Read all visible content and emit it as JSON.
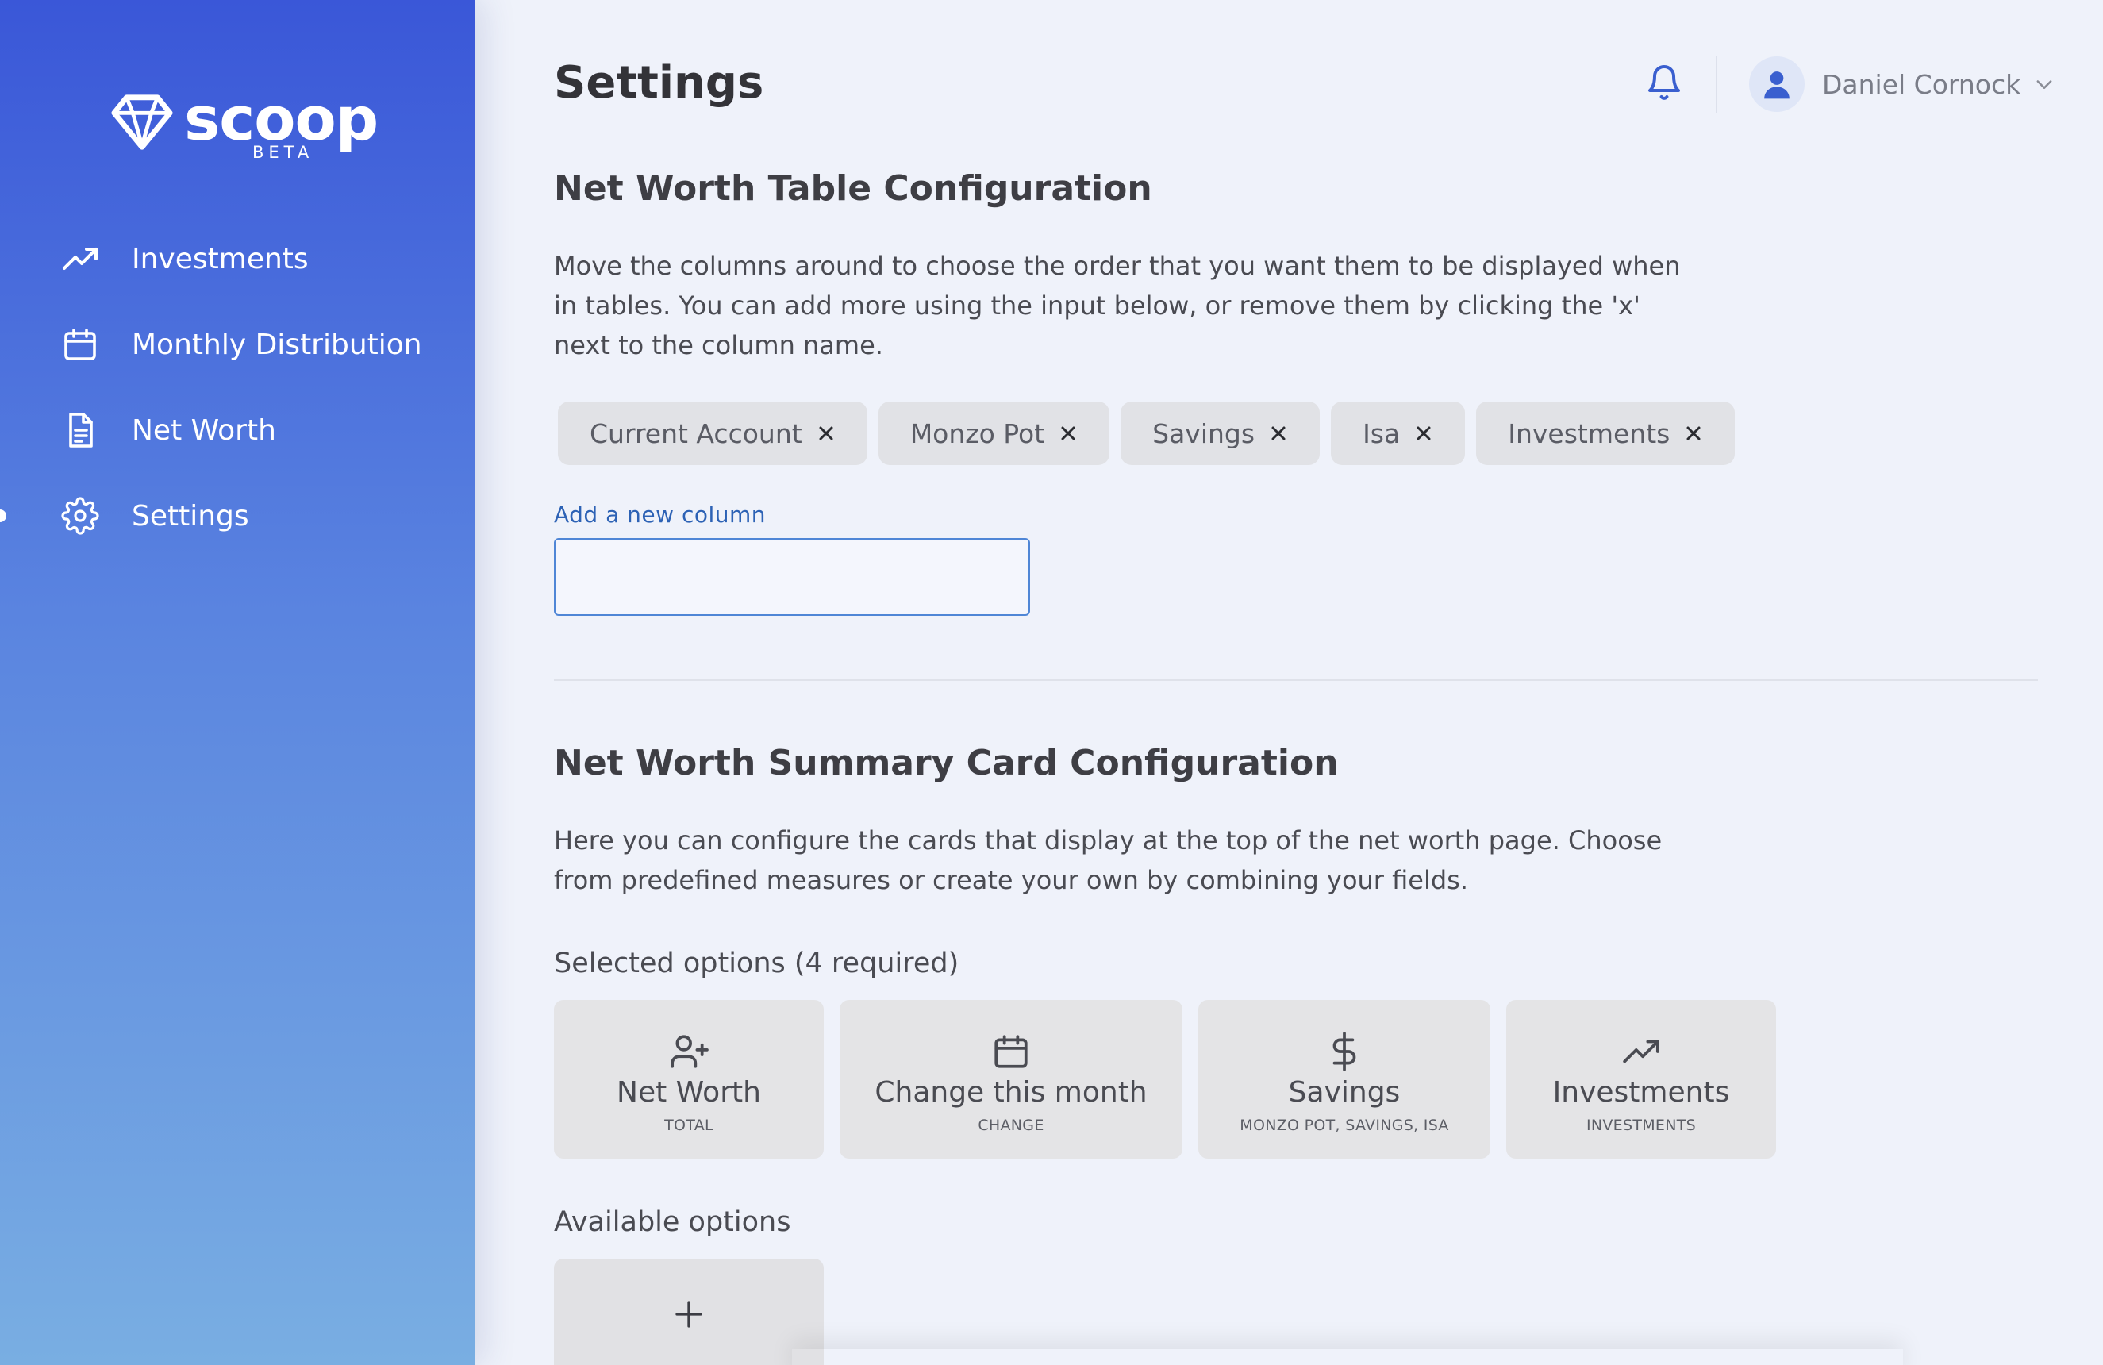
{
  "brand": {
    "name": "scoop",
    "tag": "BETA",
    "icon": "diamond-icon"
  },
  "sidebar": {
    "items": [
      {
        "label": "Investments",
        "icon": "trending-up-icon",
        "active": false
      },
      {
        "label": "Monthly Distribution",
        "icon": "calendar-icon",
        "active": false
      },
      {
        "label": "Net Worth",
        "icon": "document-icon",
        "active": false
      },
      {
        "label": "Settings",
        "icon": "gear-icon",
        "active": true
      }
    ]
  },
  "header": {
    "title": "Settings",
    "user_name": "Daniel Cornock",
    "bell_icon": "bell-icon",
    "avatar_icon": "user-icon"
  },
  "table_config": {
    "title": "Net Worth Table Configuration",
    "description": "Move the columns around to choose the order that you want them to be displayed when in tables. You can add more using the input below, or remove them by clicking the 'x' next to the column name.",
    "columns": [
      "Current Account",
      "Monzo Pot",
      "Savings",
      "Isa",
      "Investments"
    ],
    "input_label": "Add a new column",
    "input_value": ""
  },
  "summary_config": {
    "title": "Net Worth Summary Card Configuration",
    "description": "Here you can configure the cards that display at the top of the net worth page. Choose from predefined measures or create your own by combining your fields.",
    "selected_label": "Selected options (4 required)",
    "selected_cards": [
      {
        "title": "Net Worth",
        "subtitle": "TOTAL",
        "icon": "user-plus-icon"
      },
      {
        "title": "Change this month",
        "subtitle": "CHANGE",
        "icon": "calendar-icon"
      },
      {
        "title": "Savings",
        "subtitle": "MONZO POT, SAVINGS, ISA",
        "icon": "dollar-icon"
      },
      {
        "title": "Investments",
        "subtitle": "INVESTMENTS",
        "icon": "trending-up-icon"
      }
    ],
    "available_label": "Available options",
    "add_icon": "plus-icon"
  },
  "colors": {
    "sidebar_top": "#3a57d8",
    "sidebar_bottom": "#79aee2",
    "accent": "#2d62b5",
    "background": "#eff2fa"
  }
}
